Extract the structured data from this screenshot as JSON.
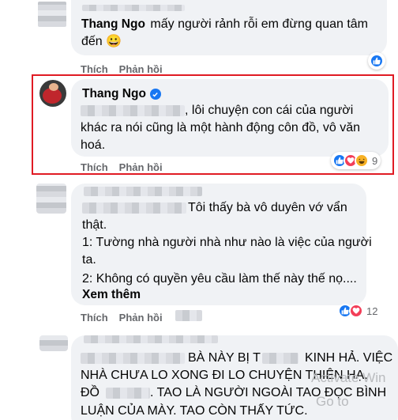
{
  "comments": [
    {
      "author": "Thang Ngo",
      "text_line1": "mấy người rảnh rỗi em đừng quan tâm",
      "text_line2": "đến",
      "emoji": "😀",
      "like_label": "Thích",
      "reply_label": "Phản hồi"
    },
    {
      "author": "Thang Ngo",
      "verified_icon": "verified-badge-icon",
      "text_line1": ", lôi chuyện con cái của người",
      "text_line2": "khác ra nói cũng là một hành động côn đồ, vô văn",
      "text_line3": "hoá.",
      "like_label": "Thích",
      "reply_label": "Phản hồi",
      "reaction_count": "9",
      "reactions": [
        "like-reaction-icon",
        "love-reaction-icon",
        "haha-reaction-icon"
      ]
    },
    {
      "text_line1": "Tôi thấy bà vô duyên vớ vẩn",
      "text_line2": "thật.",
      "text_line3": "1: Tường nhà người nhà như nào là việc của người",
      "text_line4": "ta.",
      "text_line5": "2: Không có quyền yêu cầu làm thế này thế nọ....",
      "see_more": "Xem thêm",
      "like_label": "Thích",
      "reply_label": "Phản hồi",
      "reaction_count": "12",
      "reactions": [
        "like-reaction-icon",
        "love-reaction-icon"
      ]
    },
    {
      "text_line1a": "BÀ NÀY BỊ T",
      "text_line1b": "KINH HẢ. VIỆC",
      "text_line2": "NHÀ CHƯA LO XONG ĐI LO CHUYỆN THIÊN HẠ.",
      "text_line3a": "ĐỒ",
      "text_line3b": ". TAO LÀ NGƯỜI NGOÀI TAO ĐỌC BÌNH",
      "text_line4": "LUẬN CỦA MÀY. TAO CÒN THẤY TỨC."
    }
  ],
  "watermark_line1": "Activate Win",
  "watermark_line2": "Go to"
}
